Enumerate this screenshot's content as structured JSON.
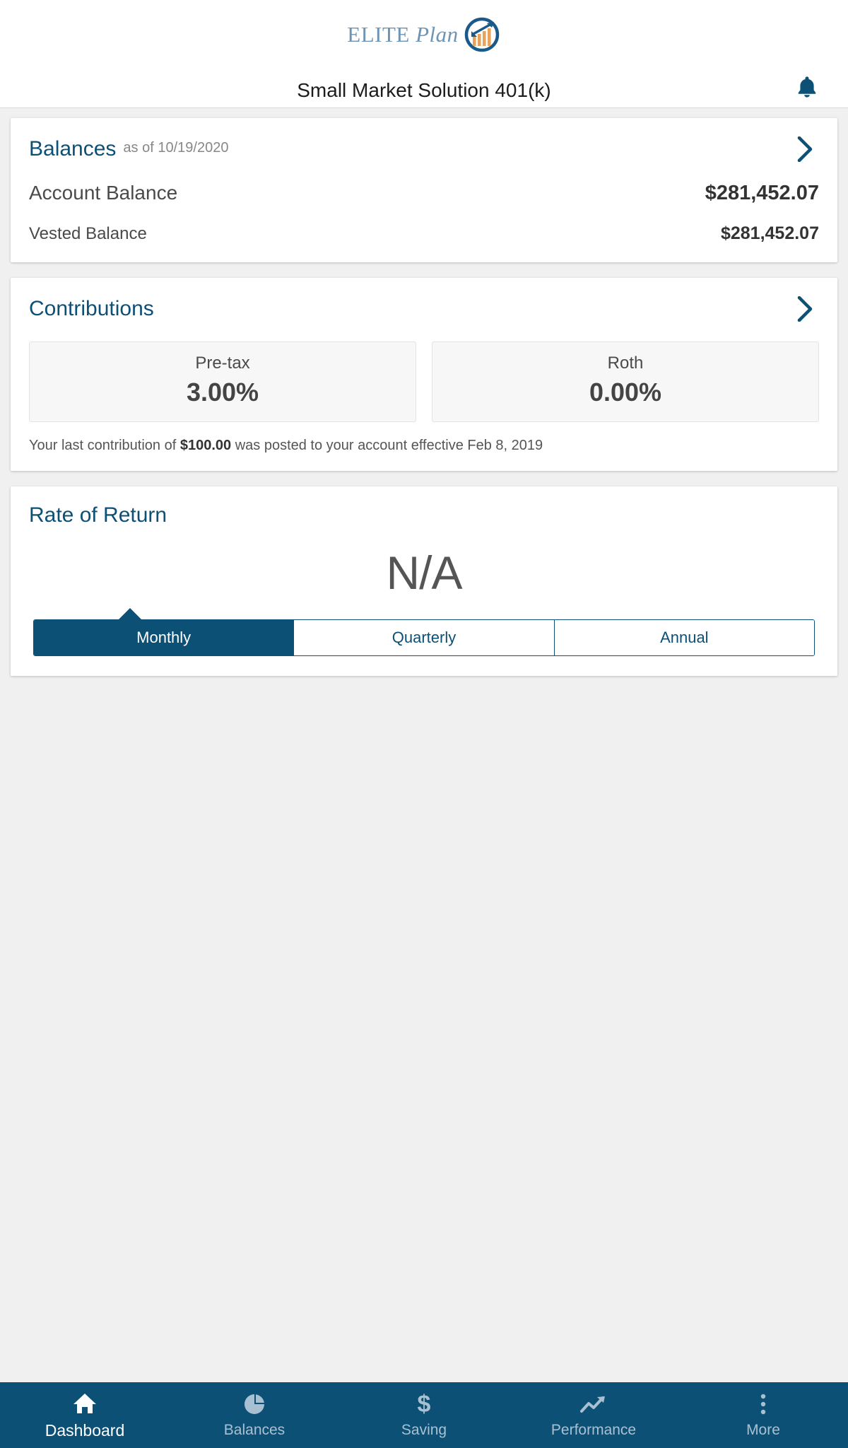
{
  "brand": {
    "logo_text_elite": "ELITE",
    "logo_text_plan": "Plan",
    "logo_mark_name": "elite-plan-chart-arrow-logo",
    "logo_text_color": "#6d94b5",
    "logo_bar_color": "#e5a35c",
    "logo_circle_color": "#1a5a8a"
  },
  "header": {
    "title": "Small Market Solution 401(k)",
    "notifications_icon": "bell-icon",
    "notifications_color": "#0d5076"
  },
  "balances_card": {
    "title": "Balances",
    "subtitle": "as of 10/19/2020",
    "chevron_icon": "chevron-right-icon",
    "rows": [
      {
        "label": "Account Balance",
        "value": "$281,452.07"
      },
      {
        "label": "Vested Balance",
        "value": "$281,452.07"
      }
    ]
  },
  "contributions_card": {
    "title": "Contributions",
    "chevron_icon": "chevron-right-icon",
    "tiles": [
      {
        "label": "Pre-tax",
        "value": "3.00%"
      },
      {
        "label": "Roth",
        "value": "0.00%"
      }
    ],
    "note_prefix": "Your last contribution of ",
    "note_amount": "$100.00",
    "note_suffix": " was posted to your account effective Feb 8, 2019"
  },
  "rate_of_return_card": {
    "title": "Rate of Return",
    "value": "N/A",
    "periods": [
      {
        "label": "Monthly",
        "active": true
      },
      {
        "label": "Quarterly",
        "active": false
      },
      {
        "label": "Annual",
        "active": false
      }
    ]
  },
  "bottom_nav": {
    "background": "#0d5076",
    "items": [
      {
        "label": "Dashboard",
        "icon": "home-icon",
        "active": true
      },
      {
        "label": "Balances",
        "icon": "pie-chart-icon",
        "active": false
      },
      {
        "label": "Saving",
        "icon": "dollar-sign-icon",
        "active": false
      },
      {
        "label": "Performance",
        "icon": "trend-up-arrow-icon",
        "active": false
      },
      {
        "label": "More",
        "icon": "kebab-menu-icon",
        "active": false
      }
    ]
  }
}
